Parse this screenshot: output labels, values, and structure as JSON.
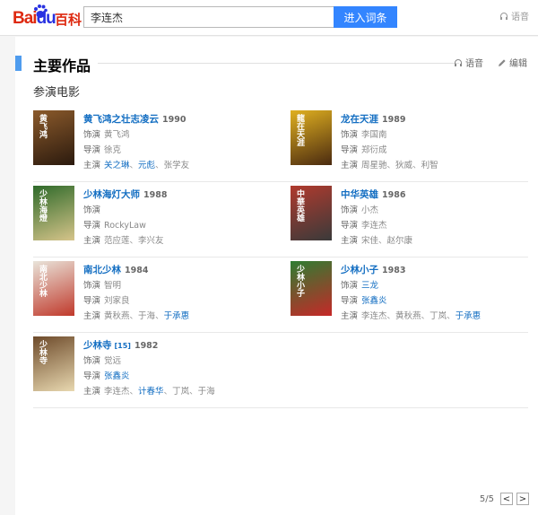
{
  "header": {
    "logo_text": "Bai",
    "logo_text2": "du",
    "logo_baike": "百科",
    "search_value": "李连杰",
    "search_button": "进入词条",
    "voice_label": "语音"
  },
  "section": {
    "title": "主要作品",
    "voice_label": "语音",
    "edit_label": "编辑",
    "subsection": "参演电影"
  },
  "labels": {
    "role": "饰演",
    "director": "导演",
    "starring": "主演"
  },
  "films": [
    {
      "title": "黄飞鸿之壮志凌云",
      "year": "1990",
      "sup": "",
      "role": [
        {
          "t": "黄飞鸿",
          "link": false
        }
      ],
      "director": [
        {
          "t": "徐克",
          "link": false
        }
      ],
      "starring": [
        {
          "t": "关之琳",
          "link": true
        },
        {
          "t": "元彪",
          "link": true
        },
        {
          "t": "张学友",
          "link": false
        }
      ],
      "poster": {
        "bg": "#8b5a2b",
        "fg": "#2b1a0e",
        "text": "黄飞鸿"
      }
    },
    {
      "title": "龙在天涯",
      "year": "1989",
      "sup": "",
      "role": [
        {
          "t": "李国南",
          "link": false
        }
      ],
      "director": [
        {
          "t": "郑衍成",
          "link": false
        }
      ],
      "starring": [
        {
          "t": "周星驰",
          "link": false
        },
        {
          "t": "狄威",
          "link": false
        },
        {
          "t": "利智",
          "link": false
        }
      ],
      "poster": {
        "bg": "#e0b020",
        "fg": "#4a2a10",
        "text": "龍在天涯"
      }
    },
    {
      "title": "少林海灯大师",
      "year": "1988",
      "sup": "",
      "role": [
        {
          "t": "",
          "link": false
        }
      ],
      "director": [
        {
          "t": "RockyLaw",
          "link": false
        }
      ],
      "starring": [
        {
          "t": "范应莲",
          "link": false
        },
        {
          "t": "李兴友",
          "link": false
        }
      ],
      "poster": {
        "bg": "#2f6a2a",
        "fg": "#d6c48a",
        "text": "少林海燈"
      }
    },
    {
      "title": "中华英雄",
      "year": "1986",
      "sup": "",
      "role": [
        {
          "t": "小杰",
          "link": false
        }
      ],
      "director": [
        {
          "t": "李连杰",
          "link": false
        }
      ],
      "starring": [
        {
          "t": "宋佳",
          "link": false
        },
        {
          "t": "赵尔康",
          "link": false
        }
      ],
      "poster": {
        "bg": "#b03a2e",
        "fg": "#3a3a3a",
        "text": "中華英雄"
      }
    },
    {
      "title": "南北少林",
      "year": "1984",
      "sup": "",
      "role": [
        {
          "t": "智明",
          "link": false
        }
      ],
      "director": [
        {
          "t": "刘家良",
          "link": false
        }
      ],
      "starring": [
        {
          "t": "黄秋燕",
          "link": false
        },
        {
          "t": "于海",
          "link": false
        },
        {
          "t": "于承惠",
          "link": true
        }
      ],
      "poster": {
        "bg": "#e9e4da",
        "fg": "#c0392b",
        "text": "南北少林"
      }
    },
    {
      "title": "少林小子",
      "year": "1983",
      "sup": "",
      "role": [
        {
          "t": "三龙",
          "link": true
        }
      ],
      "director": [
        {
          "t": "张鑫炎",
          "link": true
        }
      ],
      "starring": [
        {
          "t": "李连杰",
          "link": false
        },
        {
          "t": "黄秋燕",
          "link": false
        },
        {
          "t": "丁岚",
          "link": false
        },
        {
          "t": "于承惠",
          "link": true
        }
      ],
      "poster": {
        "bg": "#2e7d32",
        "fg": "#c62828",
        "text": "少林小子"
      }
    },
    {
      "title": "少林寺",
      "year": "1982",
      "sup": "[15]",
      "role": [
        {
          "t": "觉远",
          "link": false
        }
      ],
      "director": [
        {
          "t": "张鑫炎",
          "link": true
        }
      ],
      "starring": [
        {
          "t": "李连杰",
          "link": false
        },
        {
          "t": "计春华",
          "link": true
        },
        {
          "t": "丁岚",
          "link": false
        },
        {
          "t": "于海",
          "link": false
        }
      ],
      "poster": {
        "bg": "#6d4a2a",
        "fg": "#e8d8b0",
        "text": "少林寺"
      }
    }
  ],
  "pager": {
    "page": "5/5",
    "prev": "<",
    "next": ">"
  }
}
